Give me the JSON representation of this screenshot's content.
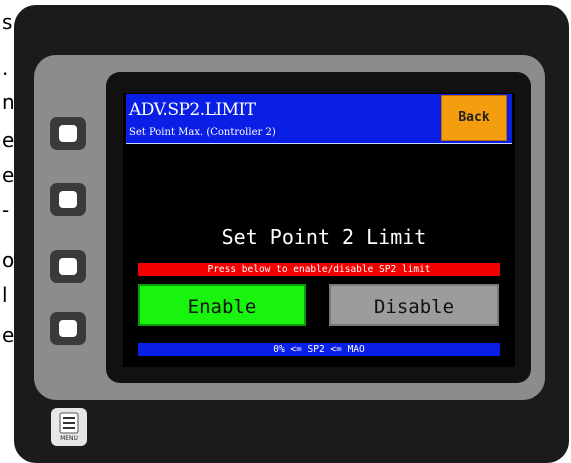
{
  "left_edge_letters": [
    "s",
    ".",
    "n",
    "e",
    "e",
    "-",
    "o",
    "l",
    "e"
  ],
  "header": {
    "title": "ADV.SP2.LIMIT",
    "subtitle": "Set Point Max. (Controller 2)",
    "back_label": "Back"
  },
  "main": {
    "heading": "Set Point 2 Limit",
    "instruction": "Press below to enable/disable SP2 limit",
    "enable_label": "Enable",
    "disable_label": "Disable",
    "range_note": "0% <= SP2 <= MAO"
  },
  "side_keys": [
    "key-1",
    "key-2",
    "key-3",
    "key-4"
  ],
  "menu": {
    "label": "MENU",
    "icon": "menu-icon"
  },
  "colors": {
    "titlebar": "#0a1fe6",
    "back_button": "#f49d0f",
    "enable_button": "#18f40e",
    "disable_button": "#9c9c9c",
    "warning_banner": "#f20000"
  }
}
